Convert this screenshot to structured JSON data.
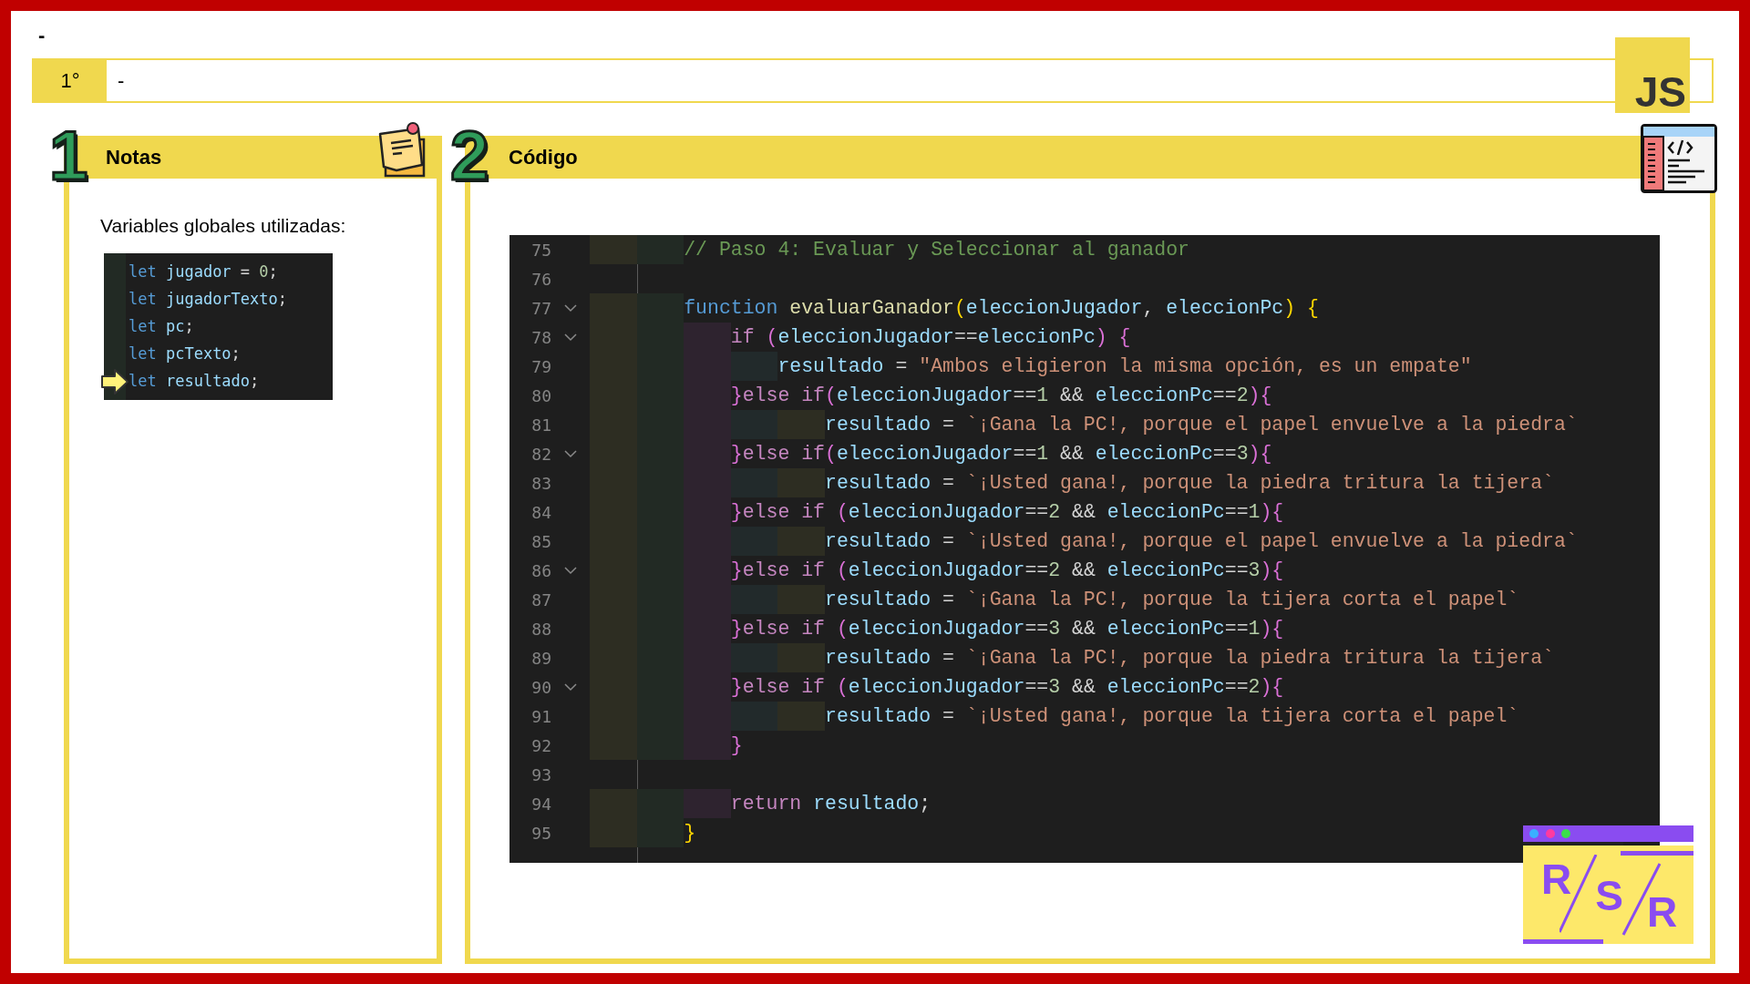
{
  "top_label": "-",
  "header": {
    "badge": "1°",
    "field_value": "-",
    "logo": "JS"
  },
  "notes": {
    "number": "1",
    "title": "Notas",
    "text": "Variables globales utilizadas:",
    "code": [
      {
        "pointer": false,
        "tokens": [
          {
            "text": "let ",
            "kind": "keyword"
          },
          {
            "text": "jugador",
            "kind": "var"
          },
          {
            "text": " = ",
            "kind": "plain"
          },
          {
            "text": "0",
            "kind": "number"
          },
          {
            "text": ";",
            "kind": "plain"
          }
        ]
      },
      {
        "pointer": false,
        "tokens": [
          {
            "text": "let ",
            "kind": "keyword"
          },
          {
            "text": "jugadorTexto",
            "kind": "var"
          },
          {
            "text": ";",
            "kind": "plain"
          }
        ]
      },
      {
        "pointer": false,
        "tokens": [
          {
            "text": "let ",
            "kind": "keyword"
          },
          {
            "text": "pc",
            "kind": "var"
          },
          {
            "text": ";",
            "kind": "plain"
          }
        ]
      },
      {
        "pointer": false,
        "tokens": [
          {
            "text": "let ",
            "kind": "keyword"
          },
          {
            "text": "pcTexto",
            "kind": "var"
          },
          {
            "text": ";",
            "kind": "plain"
          }
        ]
      },
      {
        "pointer": true,
        "tokens": [
          {
            "text": "let ",
            "kind": "keyword"
          },
          {
            "text": "resultado",
            "kind": "var"
          },
          {
            "text": ";",
            "kind": "plain"
          }
        ]
      }
    ]
  },
  "code_panel": {
    "number": "2",
    "title": "Código",
    "lines": [
      {
        "number": "75",
        "foldable": false,
        "tokens": [
          {
            "text": "        // Paso 4: Evaluar y Seleccionar al ganador",
            "kind": "comment"
          }
        ]
      },
      {
        "number": "76",
        "foldable": false
      },
      {
        "number": "77",
        "foldable": true,
        "tokens": [
          {
            "text": "        function ",
            "kind": "keyword"
          },
          {
            "text": "evaluarGanador",
            "kind": "func"
          },
          {
            "text": "(",
            "kind": "bracket1"
          },
          {
            "text": "eleccionJugador",
            "kind": "var"
          },
          {
            "text": ", ",
            "kind": "plain"
          },
          {
            "text": "eleccionPc",
            "kind": "var"
          },
          {
            "text": ") {",
            "kind": "bracket1"
          }
        ]
      },
      {
        "number": "78",
        "foldable": true,
        "tokens": [
          {
            "text": "            if ",
            "kind": "control"
          },
          {
            "text": "(",
            "kind": "bracket2"
          },
          {
            "text": "eleccionJugador",
            "kind": "var"
          },
          {
            "text": "==",
            "kind": "plain"
          },
          {
            "text": "eleccionPc",
            "kind": "var"
          },
          {
            "text": ") {",
            "kind": "bracket2"
          }
        ]
      },
      {
        "number": "79",
        "foldable": false,
        "tokens": [
          {
            "text": "                resultado",
            "kind": "var"
          },
          {
            "text": " = ",
            "kind": "plain"
          },
          {
            "text": "\"Ambos eligieron la misma opción, es un empate\"",
            "kind": "string"
          }
        ]
      },
      {
        "number": "80",
        "foldable": false,
        "tokens": [
          {
            "text": "            }",
            "kind": "bracket2"
          },
          {
            "text": "else if",
            "kind": "control"
          },
          {
            "text": "(",
            "kind": "bracket2"
          },
          {
            "text": "eleccionJugador",
            "kind": "var"
          },
          {
            "text": "==",
            "kind": "plain"
          },
          {
            "text": "1",
            "kind": "number"
          },
          {
            "text": " && ",
            "kind": "plain"
          },
          {
            "text": "eleccionPc",
            "kind": "var"
          },
          {
            "text": "==",
            "kind": "plain"
          },
          {
            "text": "2",
            "kind": "number"
          },
          {
            "text": "){",
            "kind": "bracket2"
          }
        ]
      },
      {
        "number": "81",
        "foldable": false,
        "tokens": [
          {
            "text": "                    resultado",
            "kind": "var"
          },
          {
            "text": " = ",
            "kind": "plain"
          },
          {
            "text": "`¡Gana la PC!, porque el papel envuelve a la piedra`",
            "kind": "string"
          }
        ]
      },
      {
        "number": "82",
        "foldable": true,
        "tokens": [
          {
            "text": "            }",
            "kind": "bracket2"
          },
          {
            "text": "else if",
            "kind": "control"
          },
          {
            "text": "(",
            "kind": "bracket2"
          },
          {
            "text": "eleccionJugador",
            "kind": "var"
          },
          {
            "text": "==",
            "kind": "plain"
          },
          {
            "text": "1",
            "kind": "number"
          },
          {
            "text": " && ",
            "kind": "plain"
          },
          {
            "text": "eleccionPc",
            "kind": "var"
          },
          {
            "text": "==",
            "kind": "plain"
          },
          {
            "text": "3",
            "kind": "number"
          },
          {
            "text": "){",
            "kind": "bracket2"
          }
        ]
      },
      {
        "number": "83",
        "foldable": false,
        "tokens": [
          {
            "text": "                    resultado",
            "kind": "var"
          },
          {
            "text": " = ",
            "kind": "plain"
          },
          {
            "text": "`¡Usted gana!, porque la piedra tritura la tijera`",
            "kind": "string"
          }
        ]
      },
      {
        "number": "84",
        "foldable": false,
        "tokens": [
          {
            "text": "            }",
            "kind": "bracket2"
          },
          {
            "text": "else if ",
            "kind": "control"
          },
          {
            "text": "(",
            "kind": "bracket2"
          },
          {
            "text": "eleccionJugador",
            "kind": "var"
          },
          {
            "text": "==",
            "kind": "plain"
          },
          {
            "text": "2",
            "kind": "number"
          },
          {
            "text": " && ",
            "kind": "plain"
          },
          {
            "text": "eleccionPc",
            "kind": "var"
          },
          {
            "text": "==",
            "kind": "plain"
          },
          {
            "text": "1",
            "kind": "number"
          },
          {
            "text": "){",
            "kind": "bracket2"
          }
        ]
      },
      {
        "number": "85",
        "foldable": false,
        "tokens": [
          {
            "text": "                    resultado",
            "kind": "var"
          },
          {
            "text": " = ",
            "kind": "plain"
          },
          {
            "text": "`¡Usted gana!, porque el papel envuelve a la piedra`",
            "kind": "string"
          }
        ]
      },
      {
        "number": "86",
        "foldable": true,
        "tokens": [
          {
            "text": "            }",
            "kind": "bracket2"
          },
          {
            "text": "else if ",
            "kind": "control"
          },
          {
            "text": "(",
            "kind": "bracket2"
          },
          {
            "text": "eleccionJugador",
            "kind": "var"
          },
          {
            "text": "==",
            "kind": "plain"
          },
          {
            "text": "2",
            "kind": "number"
          },
          {
            "text": " && ",
            "kind": "plain"
          },
          {
            "text": "eleccionPc",
            "kind": "var"
          },
          {
            "text": "==",
            "kind": "plain"
          },
          {
            "text": "3",
            "kind": "number"
          },
          {
            "text": "){",
            "kind": "bracket2"
          }
        ]
      },
      {
        "number": "87",
        "foldable": false,
        "tokens": [
          {
            "text": "                    resultado",
            "kind": "var"
          },
          {
            "text": " = ",
            "kind": "plain"
          },
          {
            "text": "`¡Gana la PC!, porque la tijera corta el papel`",
            "kind": "string"
          }
        ]
      },
      {
        "number": "88",
        "foldable": false,
        "tokens": [
          {
            "text": "            }",
            "kind": "bracket2"
          },
          {
            "text": "else if ",
            "kind": "control"
          },
          {
            "text": "(",
            "kind": "bracket2"
          },
          {
            "text": "eleccionJugador",
            "kind": "var"
          },
          {
            "text": "==",
            "kind": "plain"
          },
          {
            "text": "3",
            "kind": "number"
          },
          {
            "text": " && ",
            "kind": "plain"
          },
          {
            "text": "eleccionPc",
            "kind": "var"
          },
          {
            "text": "==",
            "kind": "plain"
          },
          {
            "text": "1",
            "kind": "number"
          },
          {
            "text": "){",
            "kind": "bracket2"
          }
        ]
      },
      {
        "number": "89",
        "foldable": false,
        "tokens": [
          {
            "text": "                    resultado",
            "kind": "var"
          },
          {
            "text": " = ",
            "kind": "plain"
          },
          {
            "text": "`¡Gana la PC!, porque la piedra tritura la tijera`",
            "kind": "string"
          }
        ]
      },
      {
        "number": "90",
        "foldable": true,
        "tokens": [
          {
            "text": "            }",
            "kind": "bracket2"
          },
          {
            "text": "else if ",
            "kind": "control"
          },
          {
            "text": "(",
            "kind": "bracket2"
          },
          {
            "text": "eleccionJugador",
            "kind": "var"
          },
          {
            "text": "==",
            "kind": "plain"
          },
          {
            "text": "3",
            "kind": "number"
          },
          {
            "text": " && ",
            "kind": "plain"
          },
          {
            "text": "eleccionPc",
            "kind": "var"
          },
          {
            "text": "==",
            "kind": "plain"
          },
          {
            "text": "2",
            "kind": "number"
          },
          {
            "text": "){",
            "kind": "bracket2"
          }
        ]
      },
      {
        "number": "91",
        "foldable": false,
        "tokens": [
          {
            "text": "                    resultado",
            "kind": "var"
          },
          {
            "text": " = ",
            "kind": "plain"
          },
          {
            "text": "`¡Usted gana!, porque la tijera corta el papel`",
            "kind": "string"
          }
        ]
      },
      {
        "number": "92",
        "foldable": false,
        "tokens": [
          {
            "text": "            }",
            "kind": "bracket2"
          }
        ]
      },
      {
        "number": "93",
        "foldable": false
      },
      {
        "number": "94",
        "foldable": false,
        "tokens": [
          {
            "text": "            return ",
            "kind": "control"
          },
          {
            "text": "resultado",
            "kind": "var"
          },
          {
            "text": ";",
            "kind": "plain"
          }
        ]
      },
      {
        "number": "95",
        "foldable": false,
        "tokens": [
          {
            "text": "        }",
            "kind": "bracket1"
          }
        ]
      }
    ]
  },
  "corner_badge": {
    "letters": [
      "R",
      "S",
      "R"
    ]
  }
}
